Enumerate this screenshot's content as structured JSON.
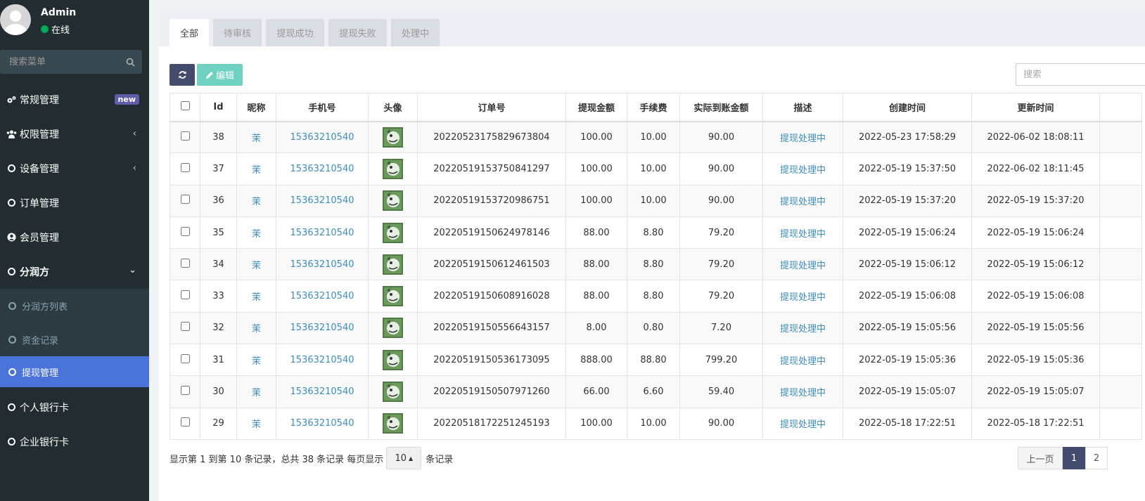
{
  "user": {
    "name": "Admin",
    "status": "在线"
  },
  "sidebar_search": {
    "placeholder": "搜索菜单"
  },
  "menu": {
    "general": {
      "label": "常规管理",
      "badge": "new"
    },
    "permission": {
      "label": "权限管理"
    },
    "device": {
      "label": "设备管理"
    },
    "order": {
      "label": "订单管理"
    },
    "member": {
      "label": "会员管理"
    },
    "profit": {
      "label": "分润方"
    },
    "profit_list": {
      "label": "分润方列表"
    },
    "fund_record": {
      "label": "资金记录"
    },
    "withdraw": {
      "label": "提现管理"
    },
    "personal_card": {
      "label": "个人银行卡"
    },
    "company_card": {
      "label": "企业银行卡"
    }
  },
  "tabs": [
    "全部",
    "待审核",
    "提现成功",
    "提现失败",
    "处理中"
  ],
  "toolbar": {
    "edit_label": "编辑",
    "search_placeholder": "搜索"
  },
  "table": {
    "headers": [
      "Id",
      "昵称",
      "手机号",
      "头像",
      "订单号",
      "提现金额",
      "手续费",
      "实际到账金额",
      "描述",
      "创建时间",
      "更新时间"
    ],
    "rows": [
      {
        "id": "38",
        "nickname": "茉",
        "phone": "15363210540",
        "order": "20220523175829673804",
        "amount": "100.00",
        "fee": "10.00",
        "actual": "90.00",
        "desc": "提现处理中",
        "created": "2022-05-23 17:58:29",
        "updated": "2022-06-02 18:08:11"
      },
      {
        "id": "37",
        "nickname": "茉",
        "phone": "15363210540",
        "order": "20220519153750841297",
        "amount": "100.00",
        "fee": "10.00",
        "actual": "90.00",
        "desc": "提现处理中",
        "created": "2022-05-19 15:37:50",
        "updated": "2022-06-02 18:11:45"
      },
      {
        "id": "36",
        "nickname": "茉",
        "phone": "15363210540",
        "order": "20220519153720986751",
        "amount": "100.00",
        "fee": "10.00",
        "actual": "90.00",
        "desc": "提现处理中",
        "created": "2022-05-19 15:37:20",
        "updated": "2022-05-19 15:37:20"
      },
      {
        "id": "35",
        "nickname": "茉",
        "phone": "15363210540",
        "order": "20220519150624978146",
        "amount": "88.00",
        "fee": "8.80",
        "actual": "79.20",
        "desc": "提现处理中",
        "created": "2022-05-19 15:06:24",
        "updated": "2022-05-19 15:06:24"
      },
      {
        "id": "34",
        "nickname": "茉",
        "phone": "15363210540",
        "order": "20220519150612461503",
        "amount": "88.00",
        "fee": "8.80",
        "actual": "79.20",
        "desc": "提现处理中",
        "created": "2022-05-19 15:06:12",
        "updated": "2022-05-19 15:06:12"
      },
      {
        "id": "33",
        "nickname": "茉",
        "phone": "15363210540",
        "order": "20220519150608916028",
        "amount": "88.00",
        "fee": "8.80",
        "actual": "79.20",
        "desc": "提现处理中",
        "created": "2022-05-19 15:06:08",
        "updated": "2022-05-19 15:06:08"
      },
      {
        "id": "32",
        "nickname": "茉",
        "phone": "15363210540",
        "order": "20220519150556643157",
        "amount": "8.00",
        "fee": "0.80",
        "actual": "7.20",
        "desc": "提现处理中",
        "created": "2022-05-19 15:05:56",
        "updated": "2022-05-19 15:05:56"
      },
      {
        "id": "31",
        "nickname": "茉",
        "phone": "15363210540",
        "order": "20220519150536173095",
        "amount": "888.00",
        "fee": "88.80",
        "actual": "799.20",
        "desc": "提现处理中",
        "created": "2022-05-19 15:05:36",
        "updated": "2022-05-19 15:05:36"
      },
      {
        "id": "30",
        "nickname": "茉",
        "phone": "15363210540",
        "order": "20220519150507971260",
        "amount": "66.00",
        "fee": "6.60",
        "actual": "59.40",
        "desc": "提现处理中",
        "created": "2022-05-19 15:05:07",
        "updated": "2022-05-19 15:05:07"
      },
      {
        "id": "29",
        "nickname": "茉",
        "phone": "15363210540",
        "order": "20220518172251245193",
        "amount": "100.00",
        "fee": "10.00",
        "actual": "90.00",
        "desc": "提现处理中",
        "created": "2022-05-18 17:22:51",
        "updated": "2022-05-18 17:22:51"
      }
    ]
  },
  "footer": {
    "info_prefix": "显示第 1 到第 10 条记录，总共 38 条记录 每页显示",
    "page_size": "10",
    "info_suffix": "条记录"
  },
  "pagination": {
    "prev": "上一页",
    "pages": [
      "1",
      "2"
    ]
  },
  "colors": {
    "sidebar_bg": "#222d32",
    "active_menu": "#4a74d9",
    "link": "#3c8dbc",
    "edit_btn": "#6fd2c0",
    "refresh_btn": "#444c6d",
    "online": "#00a65a",
    "badge": "#605ca8"
  }
}
